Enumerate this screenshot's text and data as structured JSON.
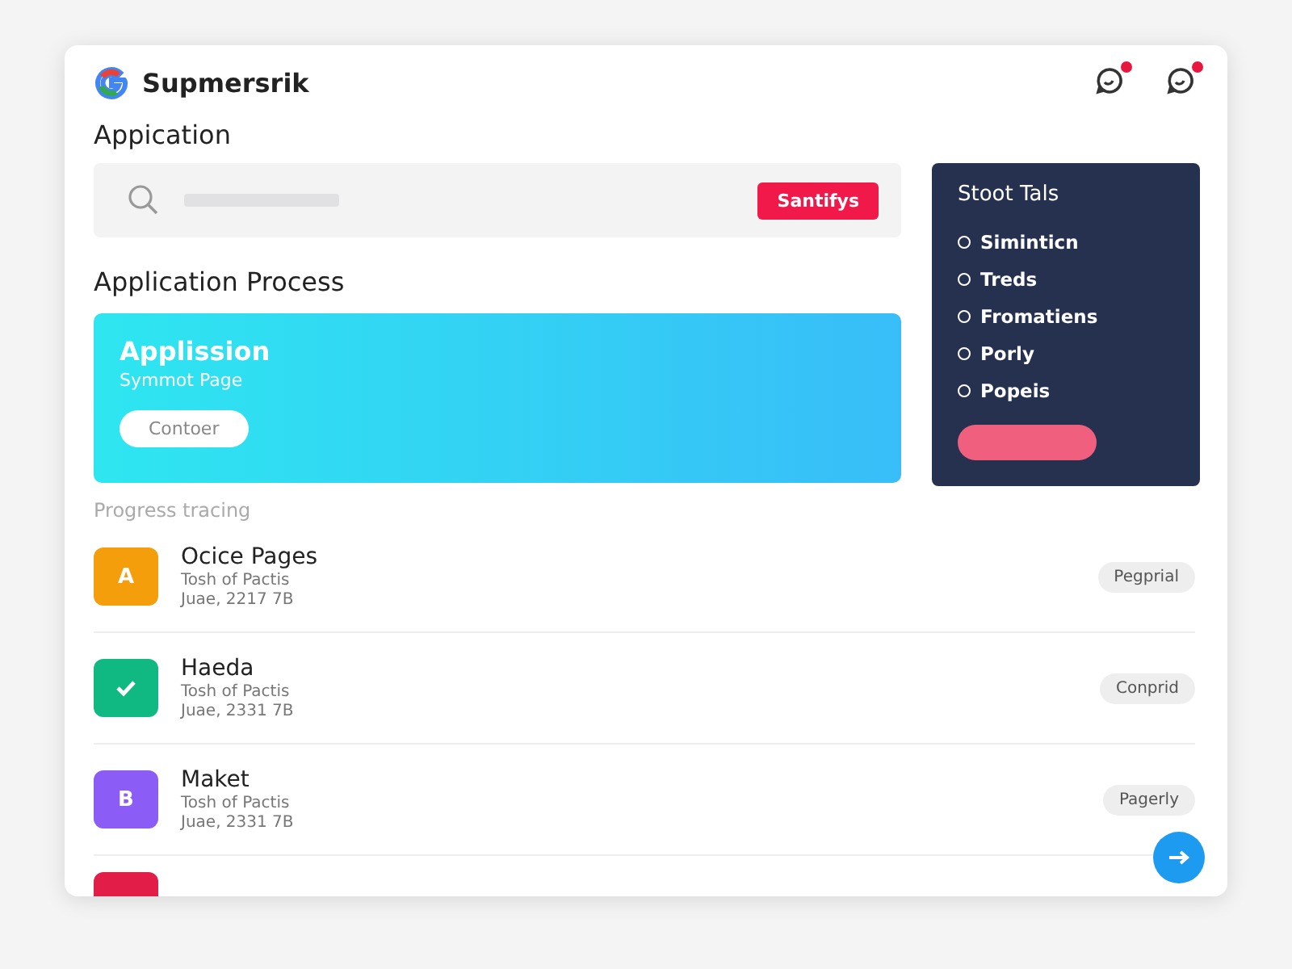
{
  "app": {
    "title": "Supmersrik",
    "notifications": [
      {
        "kind": "chat"
      },
      {
        "kind": "chat"
      }
    ]
  },
  "page_title": "Appication",
  "search": {
    "button": "Santifys"
  },
  "section_title": "Application Process",
  "hero": {
    "title": "Applission",
    "subtitle": "Symmot Page",
    "button": "Contoer"
  },
  "sidebar": {
    "title": "Stoot Tals",
    "items": [
      {
        "label": "Siminticn"
      },
      {
        "label": "Treds"
      },
      {
        "label": "Fromatiens"
      },
      {
        "label": "Porly"
      },
      {
        "label": "Popeis"
      }
    ]
  },
  "progress_title": "Progress tracing",
  "rows": [
    {
      "kind": "letter",
      "icon_text": "A",
      "color": "#f59e0b",
      "name": "Ocice Pages",
      "line1": "Tosh of Pactis",
      "line2": "Juae, 2217 7B",
      "status": "Pegprial"
    },
    {
      "kind": "check",
      "color": "#10b981",
      "name": "Haeda",
      "line1": "Tosh of Pactis",
      "line2": "Juae, 2331 7B",
      "status": "Conprid"
    },
    {
      "kind": "letter",
      "icon_text": "B",
      "color": "#8b5cf6",
      "name": "Maket",
      "line1": "Tosh of Pactis",
      "line2": "Juae, 2331 7B",
      "status": "Pagerly"
    },
    {
      "kind": "partial",
      "color": "#e11d48"
    }
  ]
}
